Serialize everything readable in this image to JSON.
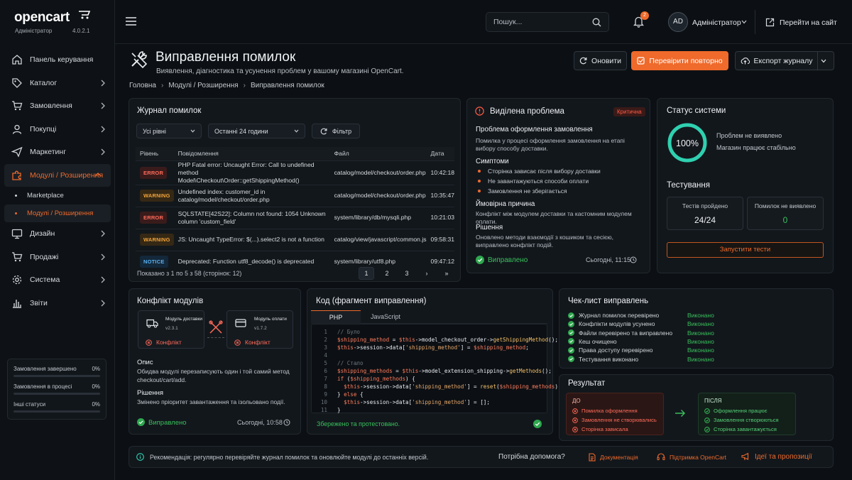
{
  "brand": {
    "logo": "opencart",
    "subtitle": "Адміністратор",
    "version": "4.0.2.1"
  },
  "sidebar": {
    "items": [
      {
        "label": "Панель керування",
        "icon": "home-icon"
      },
      {
        "label": "Каталог",
        "icon": "tag-icon"
      },
      {
        "label": "Замовлення",
        "icon": "cart-icon"
      },
      {
        "label": "Покупці",
        "icon": "user-icon"
      },
      {
        "label": "Маркетинг",
        "icon": "send-icon"
      },
      {
        "label": "Модулі / Розширення",
        "icon": "puzzle-icon"
      },
      {
        "label": "Дизайн",
        "icon": "monitor-icon"
      },
      {
        "label": "Продажі",
        "icon": "cart-icon"
      },
      {
        "label": "Система",
        "icon": "gear-icon"
      },
      {
        "label": "Звіти",
        "icon": "bar-chart-icon"
      }
    ],
    "subitems": [
      {
        "label": "Marketplace"
      },
      {
        "label": "Модулі / Розширення"
      }
    ],
    "stats": [
      {
        "label": "Замовлення завершено",
        "value": "0%"
      },
      {
        "label": "Замовлення в процесі",
        "value": "0%"
      },
      {
        "label": "Інші статуси",
        "value": "0%"
      }
    ]
  },
  "topbar": {
    "search_placeholder": "Пошук...",
    "notifications": "2",
    "avatar": "AD",
    "user": "Адміністратор",
    "store_link": "Перейти на сайт"
  },
  "header": {
    "title": "Виправлення помилок",
    "subtitle": "Виявлення, діагностика та усунення проблем у вашому магазині OpenCart.",
    "breadcrumb": [
      "Головна",
      "Модулі / Розширення",
      "Виправлення помилок"
    ],
    "refresh": "Оновити",
    "recheck": "Перевірити повторно",
    "export": "Експорт журналу"
  },
  "log": {
    "title": "Журнал помилок",
    "level_filter": "Усі рівні",
    "time_filter": "Останні 24 години",
    "filter_btn": "Фільтр",
    "columns": [
      "Рівень",
      "Повідомлення",
      "Файл",
      "Дата"
    ],
    "rows": [
      {
        "level": "ERROR",
        "kind": "error",
        "msg1": "PHP Fatal error: Uncaught Error: Call to undefined method",
        "msg2": "Model\\Checkout\\Order::getShippingMethod()",
        "file": "catalog/model/checkout/order.php",
        "time": "10:42:18"
      },
      {
        "level": "WARNING",
        "kind": "warning",
        "msg1": "Undefined index: customer_id in",
        "msg2": "catalog/model/checkout/order.php",
        "file": "catalog/model/checkout/order.php",
        "time": "10:35:47"
      },
      {
        "level": "ERROR",
        "kind": "error",
        "msg1": "SQLSTATE[42S22]: Column not found: 1054 Unknown",
        "msg2": "column 'custom_field'",
        "file": "system/library/db/mysqli.php",
        "time": "10:21:03"
      },
      {
        "level": "WARNING",
        "kind": "warning",
        "msg1": "JS: Uncaught TypeError: $(...).select2 is not a function",
        "msg2": "",
        "file": "catalog/view/javascript/common.js",
        "time": "09:58:31"
      },
      {
        "level": "NOTICE",
        "kind": "notice",
        "msg1": "Deprecated: Function utf8_decode() is deprecated",
        "msg2": "",
        "file": "system/library/utf8.php",
        "time": "09:47:12"
      }
    ],
    "footer": "Показано з 1 по 5 з 58 (сторінок: 12)",
    "pages": [
      "1",
      "2",
      "3",
      "›",
      "»"
    ]
  },
  "problem": {
    "title": "Виділена проблема",
    "badge": "Критична",
    "heading": "Проблема оформлення замовлення",
    "desc": "Помилка у процесі оформлення замовлення на етапі вибору способу доставки.",
    "symptoms_title": "Симптоми",
    "symptoms": [
      "Сторінка зависає після вибору доставки",
      "Не завантажуються способи оплати",
      "Замовлення не зберігається"
    ],
    "cause_title": "Ймовірна причина",
    "cause": "Конфлікт між модулем доставки та кастомним модулем оплати.",
    "solution_title": "Рішення",
    "solution": "Оновлено методи взаємодії з кошиком та сесією, виправлено конфлікт подій.",
    "status": "Виправлено",
    "date": "Сьогодні, 11:15"
  },
  "system": {
    "title": "Статус системи",
    "percent": "100%",
    "progress": 100,
    "line1": "Проблем не виявлено",
    "line2": "Магазин працює стабільно",
    "tests_title": "Тестування",
    "passed_label": "Тестів пройдено",
    "passed_value": "24/24",
    "found_label": "Помилок не виявлено",
    "found_value": "0",
    "run_btn": "Запустити тести"
  },
  "conflict": {
    "title": "Конфлікт модулів",
    "mod1_name": "Модуль доставки",
    "mod1_ver": "v2.3.1",
    "mod2_name": "Модуль оплати",
    "mod2_ver": "v1.7.2",
    "conflict_label": "Конфлікт",
    "desc_title": "Опис",
    "desc": "Обидва модулі перезаписують один і той самий метод checkout/cart/add.",
    "sol_title": "Рішення",
    "sol": "Змінено пріоритет завантаження та ізольовано події.",
    "status": "Виправлено",
    "date": "Сьогодні, 10:58"
  },
  "code": {
    "title": "Код (фрагмент виправлення)",
    "tabs": [
      "PHP",
      "JavaScript"
    ],
    "saved": "Збережено та протестовано."
  },
  "checklist": {
    "title": "Чек-лист виправлень",
    "items": [
      {
        "label": "Журнал помилок перевірено",
        "status": "Виконано"
      },
      {
        "label": "Конфлікти модулів усунено",
        "status": "Виконано"
      },
      {
        "label": "Файли перевірено та виправлено",
        "status": "Виконано"
      },
      {
        "label": "Кеш очищено",
        "status": "Виконано"
      },
      {
        "label": "Права доступу перевірено",
        "status": "Виконано"
      },
      {
        "label": "Тестування виконано",
        "status": "Виконано"
      }
    ]
  },
  "result": {
    "title": "Результат",
    "before_title": "ДО",
    "before": [
      "Помилка оформлення",
      "Замовлення не створювались",
      "Сторінка зависала"
    ],
    "after_title": "ПІСЛЯ",
    "after": [
      "Оформлення працює",
      "Замовлення створюються",
      "Сторінка завантажується"
    ]
  },
  "footer": {
    "tip": "Рекомендація: регулярно перевіряйте журнал помилок та оновлюйте модулі до останніх версій.",
    "help": "Потрібна допомога?",
    "docs": "Документація",
    "support": "Підтримка OpenCart",
    "ideas": "Ідеї та пропозиції"
  },
  "colors": {
    "accent": "#ef6a2b",
    "success": "#39c05b",
    "danger": "#ff5b45",
    "background": "#0c1014"
  }
}
